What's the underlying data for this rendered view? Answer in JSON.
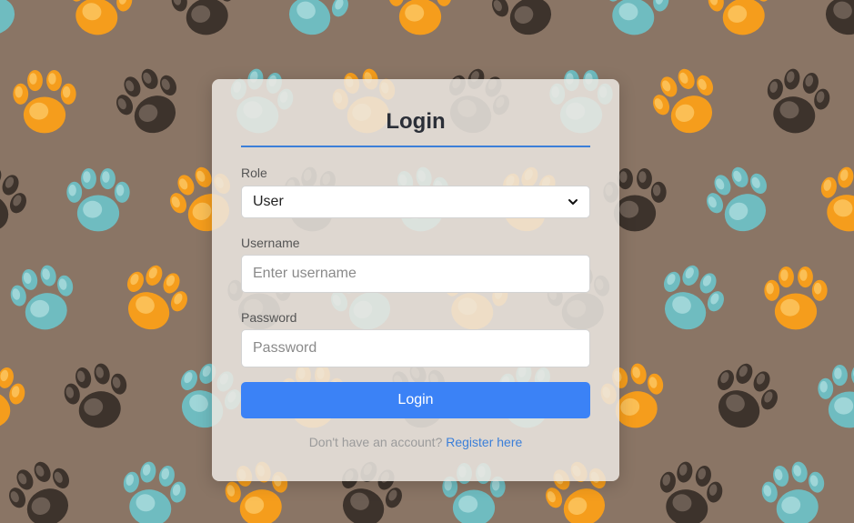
{
  "login": {
    "title": "Login",
    "role_label": "Role",
    "role_value": "User",
    "username_label": "Username",
    "username_placeholder": "Enter username",
    "password_label": "Password",
    "password_placeholder": "Password",
    "submit_label": "Login",
    "footer_text": "Don't have an account?",
    "register_link": "Register here"
  },
  "colors": {
    "background": "#8a7565",
    "accent": "#3b82f6",
    "paw_orange": "#f59d1c",
    "paw_teal": "#6fbcc0",
    "paw_dark": "#3d332c"
  },
  "icons": {
    "background": "paw-print-pattern",
    "select": "chevron-down-icon"
  }
}
